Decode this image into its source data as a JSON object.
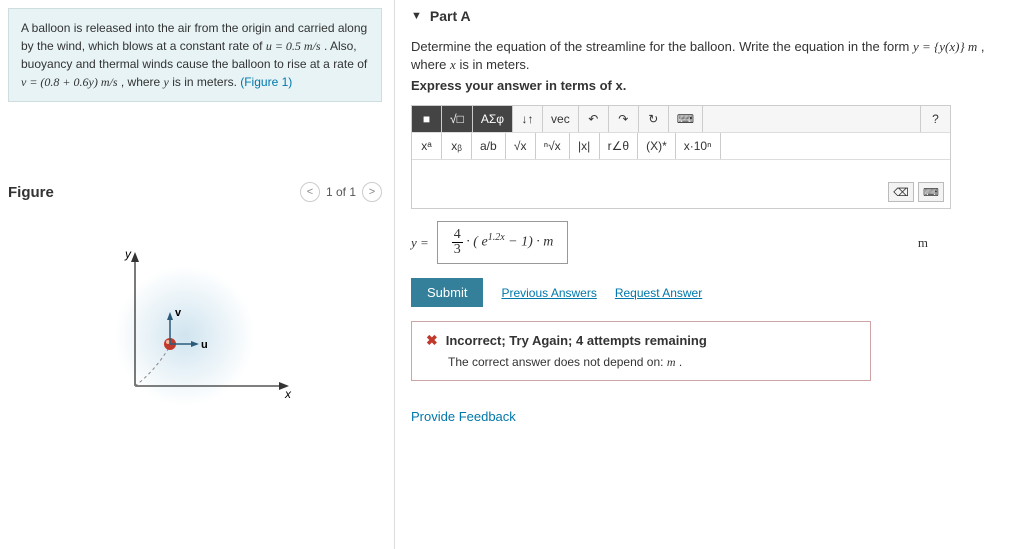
{
  "problem": {
    "line1_pre": "A balloon is released into the air from the origin and carried along by the wind, which blows at a constant rate of ",
    "u_eq": "u = 0.5 m/s",
    "line1_post": ". Also, buoyancy and thermal winds cause the balloon to rise at a rate of",
    "v_eq": "v = (0.8 + 0.6y) m/s",
    "v_post": ", where ",
    "y_var": "y",
    "v_tail": " is in meters. ",
    "figref": "(Figure 1)"
  },
  "figure": {
    "title": "Figure",
    "pager": "1 of 1"
  },
  "part": {
    "label": "Part A",
    "prompt": "Determine the equation of the streamline for the balloon. Write the equation in the form ",
    "eq_form": "y = {y(x)} m",
    "prompt_tail": ", where ",
    "xvar": "x",
    "prompt_end": " is in meters.",
    "express": "Express your answer in terms of x."
  },
  "toolbar1": {
    "b1": "■",
    "b2": "√□",
    "b3": "ΑΣφ",
    "b4": "↓↑",
    "b5": "vec",
    "undo": "↶",
    "redo": "↷",
    "reset": "↻",
    "kb": "⌨",
    "help": "?"
  },
  "toolbar2": {
    "b1": "xᵃ",
    "b2": "xᵦ",
    "b3": "a/b",
    "b4": "√x",
    "b5": "ⁿ√x",
    "b6": "|x|",
    "b7": "r∠θ",
    "b8": "(X)*",
    "b9": "x·10ⁿ"
  },
  "input_ctrls": {
    "bs": "⌫",
    "kb": "⌨"
  },
  "answer": {
    "prefix": "y = ",
    "frac_num": "4",
    "frac_den": "3",
    "mult": " · (",
    "e": "e",
    "exp": "1.2x",
    "rest": " − 1) · ",
    "mvar": "m",
    "unit": "m"
  },
  "submit": {
    "label": "Submit",
    "link1": "Previous Answers",
    "link2": "Request Answer"
  },
  "feedback": {
    "line1": "Incorrect; Try Again; 4 attempts remaining",
    "line2_pre": "The correct answer does not depend on: ",
    "line2_var": "m",
    "line2_post": "."
  },
  "provide": "Provide Feedback"
}
